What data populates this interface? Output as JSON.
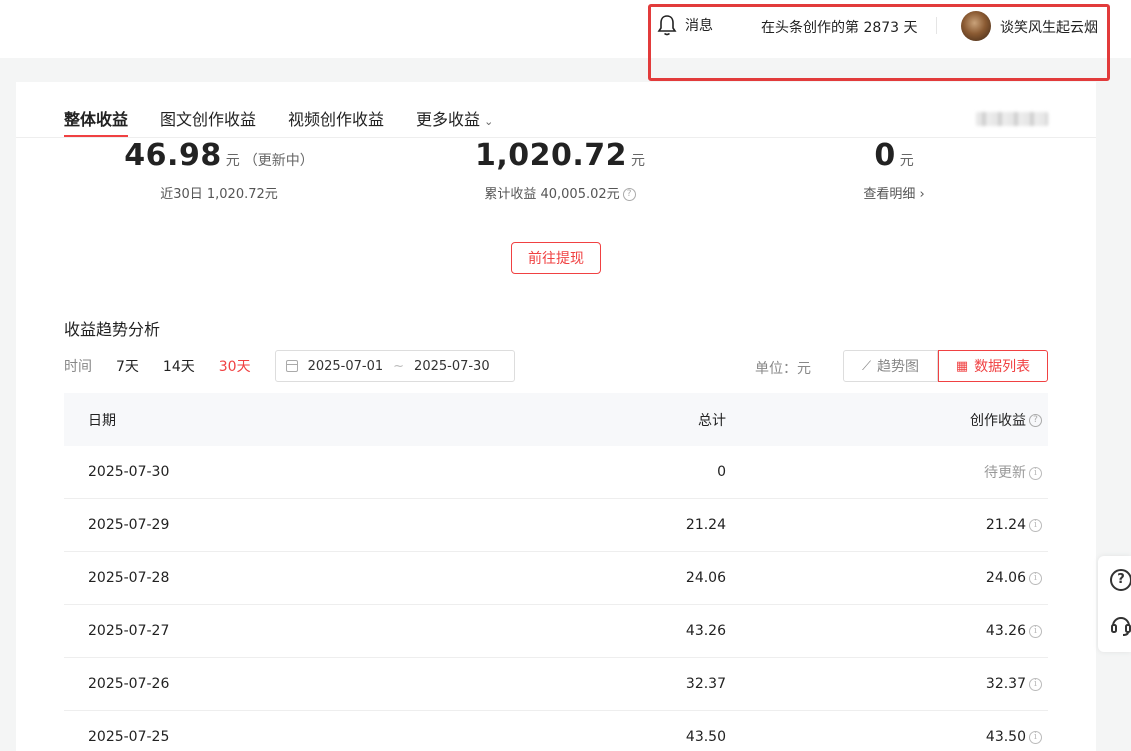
{
  "header": {
    "messages_label": "消息",
    "creation_days": "在头条创作的第 2873 天",
    "username": "谈笑风生起云烟",
    "highlight_color": "#e23b3b"
  },
  "tabs": [
    {
      "label": "整体收益",
      "active": true
    },
    {
      "label": "图文创作收益",
      "active": false
    },
    {
      "label": "视频创作收益",
      "active": false
    },
    {
      "label": "更多收益",
      "active": false
    }
  ],
  "stats": {
    "today": {
      "value": "46.98",
      "unit": "元",
      "note": "（更新中）",
      "sub": "近30日 1,020.72元"
    },
    "month": {
      "value": "1,020.72",
      "unit": "元",
      "sub": "累计收益 40,005.02元"
    },
    "pending": {
      "value": "0",
      "unit": "元",
      "sub": "查看明细 ›"
    }
  },
  "withdraw_label": "前往提现",
  "trend": {
    "title": "收益趋势分析",
    "time_label": "时间",
    "options": [
      "7天",
      "14天",
      "30天"
    ],
    "selected": "30天",
    "date_start": "2025-07-01",
    "date_sep": "~",
    "date_end": "2025-07-30",
    "unit_label": "单位：元",
    "view_chart": "趋势图",
    "view_table": "数据列表"
  },
  "table": {
    "headers": {
      "date": "日期",
      "total": "总计",
      "creation": "创作收益"
    },
    "rows": [
      {
        "date": "2025-07-30",
        "total": "0",
        "creation": "待更新"
      },
      {
        "date": "2025-07-29",
        "total": "21.24",
        "creation": "21.24"
      },
      {
        "date": "2025-07-28",
        "total": "24.06",
        "creation": "24.06"
      },
      {
        "date": "2025-07-27",
        "total": "43.26",
        "creation": "43.26"
      },
      {
        "date": "2025-07-26",
        "total": "32.37",
        "creation": "32.37"
      },
      {
        "date": "2025-07-25",
        "total": "43.50",
        "creation": "43.50"
      }
    ]
  },
  "accent_color": "#f04142"
}
